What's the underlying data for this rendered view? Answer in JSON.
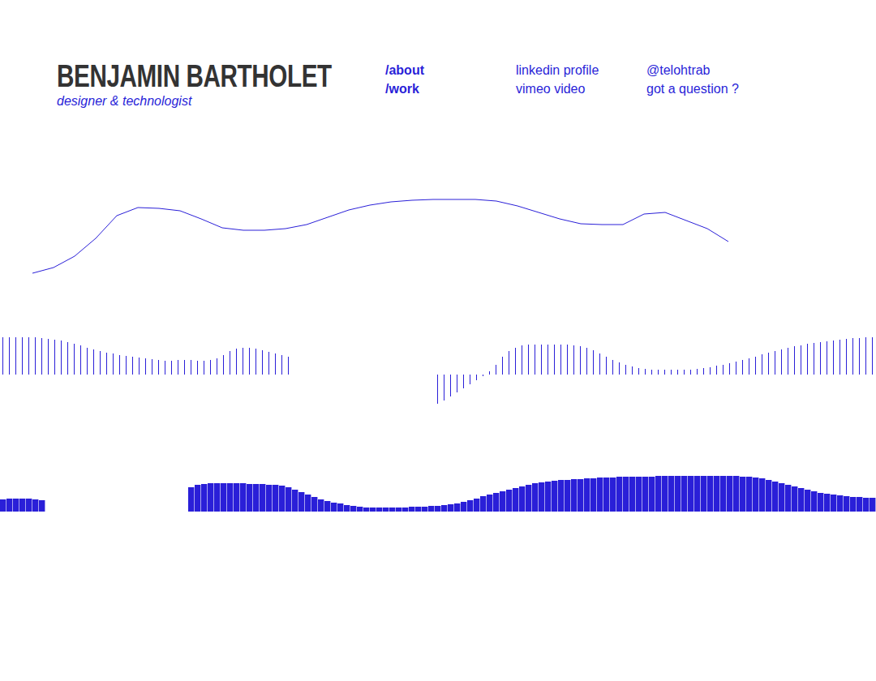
{
  "header": {
    "name": "BENJAMIN BARTHOLET",
    "tagline": "designer & technologist"
  },
  "nav": {
    "columns": [
      [
        {
          "label": "/about",
          "kind": "section"
        },
        {
          "label": "/work",
          "kind": "section"
        }
      ],
      [
        {
          "label": "linkedin profile",
          "kind": "link"
        },
        {
          "label": "vimeo video",
          "kind": "link"
        }
      ],
      [
        {
          "label": "@telohtrab",
          "kind": "link"
        },
        {
          "label": "got a question ?",
          "kind": "link"
        }
      ]
    ]
  },
  "waveforms": [
    {
      "kind": "line",
      "values": [
        17,
        24,
        38,
        60,
        88,
        98,
        97,
        94,
        84,
        73,
        70,
        70,
        72,
        77,
        86,
        95,
        101,
        105,
        107,
        108,
        108,
        108,
        106,
        100,
        92,
        84,
        78,
        77,
        77,
        90,
        92,
        82,
        72,
        56
      ]
    },
    {
      "kind": "bars",
      "values": [
        46,
        46,
        46,
        46,
        46,
        46,
        45,
        44,
        43,
        42,
        40,
        38,
        36,
        33,
        31,
        29,
        27,
        26,
        24,
        23,
        22,
        21,
        20,
        19,
        18,
        17,
        17,
        18,
        18,
        18,
        17,
        17,
        18,
        20,
        24,
        29,
        32,
        33,
        33,
        32,
        30,
        28,
        26,
        24,
        22,
        null,
        null,
        null,
        null,
        null,
        null,
        null,
        null,
        null,
        null,
        null,
        null,
        null,
        null,
        null,
        null,
        null,
        null,
        null,
        null,
        null,
        null,
        -36,
        -32,
        -27,
        -22,
        -17,
        -12,
        -7,
        -2,
        4,
        12,
        22,
        29,
        33,
        36,
        37,
        37,
        37,
        37,
        37,
        37,
        37,
        36,
        35,
        33,
        30,
        26,
        22,
        18,
        15,
        12,
        10,
        8,
        7,
        6,
        6,
        6,
        6,
        6,
        6,
        6,
        7,
        8,
        9,
        11,
        12,
        14,
        16,
        18,
        20,
        22,
        25,
        27,
        29,
        31,
        33,
        35,
        36,
        38,
        39,
        40,
        41,
        42,
        43,
        44,
        45,
        45,
        46,
        46
      ]
    },
    {
      "kind": "filled",
      "values": [
        15,
        16,
        16,
        16,
        16,
        15,
        14,
        null,
        null,
        null,
        null,
        null,
        null,
        null,
        null,
        null,
        null,
        null,
        null,
        null,
        null,
        null,
        null,
        null,
        null,
        null,
        null,
        null,
        null,
        30,
        33,
        34,
        35,
        35,
        35,
        35,
        35,
        35,
        34,
        34,
        34,
        33,
        33,
        32,
        30,
        27,
        24,
        21,
        18,
        15,
        13,
        11,
        10,
        8,
        7,
        6,
        5,
        5,
        5,
        5,
        5,
        5,
        5,
        6,
        6,
        6,
        7,
        7,
        8,
        9,
        10,
        12,
        14,
        16,
        19,
        21,
        23,
        25,
        27,
        29,
        31,
        33,
        35,
        36,
        37,
        38,
        39,
        39,
        40,
        40,
        41,
        41,
        42,
        42,
        42,
        43,
        43,
        43,
        43,
        43,
        43,
        44,
        44,
        44,
        44,
        44,
        44,
        44,
        44,
        44,
        44,
        44,
        44,
        44,
        43,
        43,
        42,
        41,
        39,
        37,
        35,
        33,
        31,
        29,
        27,
        25,
        23,
        22,
        21,
        20,
        19,
        18,
        18,
        17,
        17
      ]
    }
  ]
}
